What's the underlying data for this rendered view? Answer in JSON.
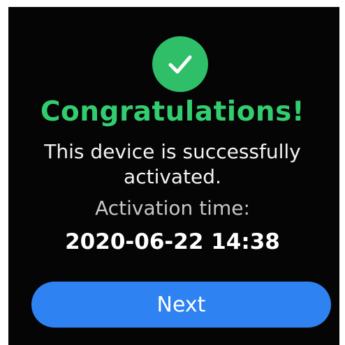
{
  "activation": {
    "title": "Congratulations!",
    "message_line1": "This device is successfully",
    "message_line2": "activated.",
    "time_label": "Activation time:",
    "time_value": "2020-06-22 14:38",
    "next_label": "Next"
  },
  "colors": {
    "success_green": "#32cd6e",
    "button_blue": "#2f82f1",
    "background": "#050505"
  },
  "icons": {
    "status": "checkmark-icon"
  }
}
